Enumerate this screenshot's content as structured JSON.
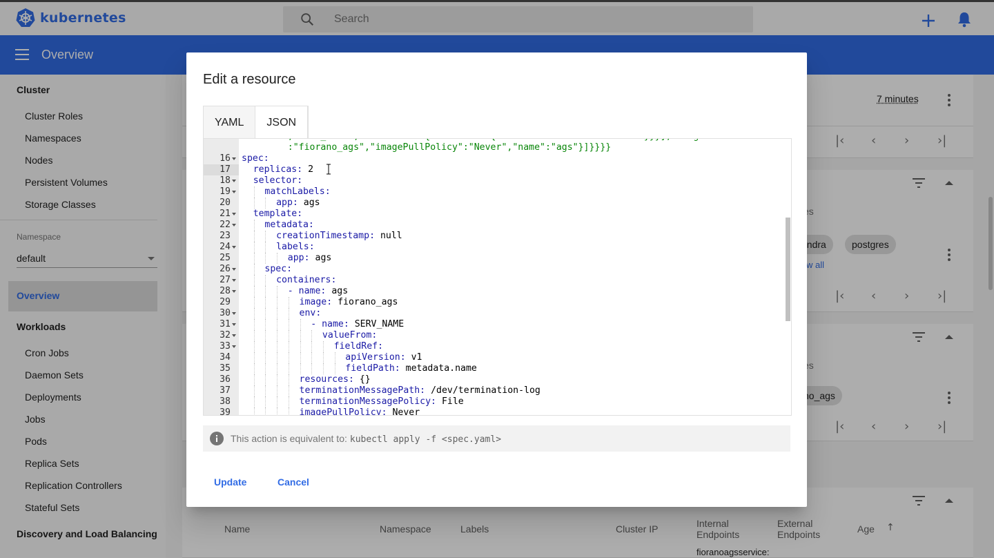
{
  "app": {
    "logo_text": "kubernetes",
    "page_title": "Overview"
  },
  "search": {
    "placeholder": "Search"
  },
  "sidebar": {
    "cluster_heading": "Cluster",
    "cluster_items": [
      "Cluster Roles",
      "Namespaces",
      "Nodes",
      "Persistent Volumes",
      "Storage Classes"
    ],
    "namespace_label": "Namespace",
    "namespace_value": "default",
    "overview_label": "Overview",
    "workloads_heading": "Workloads",
    "workload_items": [
      "Cron Jobs",
      "Daemon Sets",
      "Deployments",
      "Jobs",
      "Pods",
      "Replica Sets",
      "Replication Controllers",
      "Stateful Sets"
    ],
    "discovery_heading": "Discovery and Load Balancing"
  },
  "background": {
    "age_value": "7 minutes",
    "chip_cassandra": "sandra",
    "chip_postgres": "postgres",
    "view_all": "w all",
    "fragment_es_1": "es",
    "fragment_es_2": "es",
    "chip_ags": "no_ags",
    "services_columns": [
      "Name",
      "Namespace",
      "Labels",
      "Cluster IP",
      "Internal Endpoints",
      "External Endpoints",
      "Age"
    ],
    "endpoint_fragment": "fioranoagsservice:"
  },
  "dialog": {
    "title": "Edit a resource",
    "tabs": [
      "YAML",
      "JSON"
    ],
    "active_tab": "JSON",
    "code_lines": [
      {
        "n": "",
        "fold": false,
        "indent": 4,
        "parts": [
          [
            "s",
            ",\"SERV_NAME\",\"valueFrom\":{\"fieldRef\":{\"fieldPath\":\"metadata.name\"}}}],\"image\""
          ]
        ]
      },
      {
        "n": "",
        "fold": false,
        "indent": 4,
        "parts": [
          [
            "s",
            ":\"fiorano_ags\",\"imagePullPolicy\":\"Never\",\"name\":\"ags\"}]}}}}"
          ]
        ]
      },
      {
        "n": "16",
        "fold": true,
        "indent": 0,
        "parts": [
          [
            "k",
            "spec:"
          ]
        ]
      },
      {
        "n": "17",
        "fold": false,
        "indent": 1,
        "parts": [
          [
            "k",
            "replicas: "
          ],
          [
            "v",
            "2"
          ]
        ]
      },
      {
        "n": "18",
        "fold": true,
        "indent": 1,
        "parts": [
          [
            "k",
            "selector:"
          ]
        ]
      },
      {
        "n": "19",
        "fold": true,
        "indent": 2,
        "parts": [
          [
            "k",
            "matchLabels:"
          ]
        ]
      },
      {
        "n": "20",
        "fold": false,
        "indent": 3,
        "parts": [
          [
            "k",
            "app: "
          ],
          [
            "v",
            "ags"
          ]
        ]
      },
      {
        "n": "21",
        "fold": true,
        "indent": 1,
        "parts": [
          [
            "k",
            "template:"
          ]
        ]
      },
      {
        "n": "22",
        "fold": true,
        "indent": 2,
        "parts": [
          [
            "k",
            "metadata:"
          ]
        ]
      },
      {
        "n": "23",
        "fold": false,
        "indent": 3,
        "parts": [
          [
            "k",
            "creationTimestamp: "
          ],
          [
            "v",
            "null"
          ]
        ]
      },
      {
        "n": "24",
        "fold": true,
        "indent": 3,
        "parts": [
          [
            "k",
            "labels:"
          ]
        ]
      },
      {
        "n": "25",
        "fold": false,
        "indent": 4,
        "parts": [
          [
            "k",
            "app: "
          ],
          [
            "v",
            "ags"
          ]
        ]
      },
      {
        "n": "26",
        "fold": true,
        "indent": 2,
        "parts": [
          [
            "k",
            "spec:"
          ]
        ]
      },
      {
        "n": "27",
        "fold": true,
        "indent": 3,
        "parts": [
          [
            "k",
            "containers:"
          ]
        ]
      },
      {
        "n": "28",
        "fold": true,
        "indent": 4,
        "parts": [
          [
            "k",
            "- name: "
          ],
          [
            "v",
            "ags"
          ]
        ]
      },
      {
        "n": "29",
        "fold": false,
        "indent": 5,
        "parts": [
          [
            "k",
            "image: "
          ],
          [
            "v",
            "fiorano_ags"
          ]
        ]
      },
      {
        "n": "30",
        "fold": true,
        "indent": 5,
        "parts": [
          [
            "k",
            "env:"
          ]
        ]
      },
      {
        "n": "31",
        "fold": true,
        "indent": 6,
        "parts": [
          [
            "k",
            "- name: "
          ],
          [
            "v",
            "SERV_NAME"
          ]
        ]
      },
      {
        "n": "32",
        "fold": true,
        "indent": 7,
        "parts": [
          [
            "k",
            "valueFrom:"
          ]
        ]
      },
      {
        "n": "33",
        "fold": true,
        "indent": 8,
        "parts": [
          [
            "k",
            "fieldRef:"
          ]
        ]
      },
      {
        "n": "34",
        "fold": false,
        "indent": 9,
        "parts": [
          [
            "k",
            "apiVersion: "
          ],
          [
            "v",
            "v1"
          ]
        ]
      },
      {
        "n": "35",
        "fold": false,
        "indent": 9,
        "parts": [
          [
            "k",
            "fieldPath: "
          ],
          [
            "v",
            "metadata.name"
          ]
        ]
      },
      {
        "n": "36",
        "fold": false,
        "indent": 5,
        "parts": [
          [
            "k",
            "resources: "
          ],
          [
            "v",
            "{}"
          ]
        ]
      },
      {
        "n": "37",
        "fold": false,
        "indent": 5,
        "parts": [
          [
            "k",
            "terminationMessagePath: "
          ],
          [
            "v",
            "/dev/termination-log"
          ]
        ]
      },
      {
        "n": "38",
        "fold": false,
        "indent": 5,
        "parts": [
          [
            "k",
            "terminationMessagePolicy: "
          ],
          [
            "v",
            "File"
          ]
        ]
      },
      {
        "n": "39",
        "fold": false,
        "indent": 5,
        "parts": [
          [
            "k",
            "imagePullPolicy: "
          ],
          [
            "v",
            "Never"
          ]
        ]
      }
    ],
    "info_text": "This action is equivalent to:",
    "info_command": "kubectl apply -f <spec.yaml>",
    "update_label": "Update",
    "cancel_label": "Cancel"
  },
  "colors": {
    "brand": "#326ce5",
    "yaml_key": "#1a1aa6",
    "yaml_string": "#098609"
  }
}
